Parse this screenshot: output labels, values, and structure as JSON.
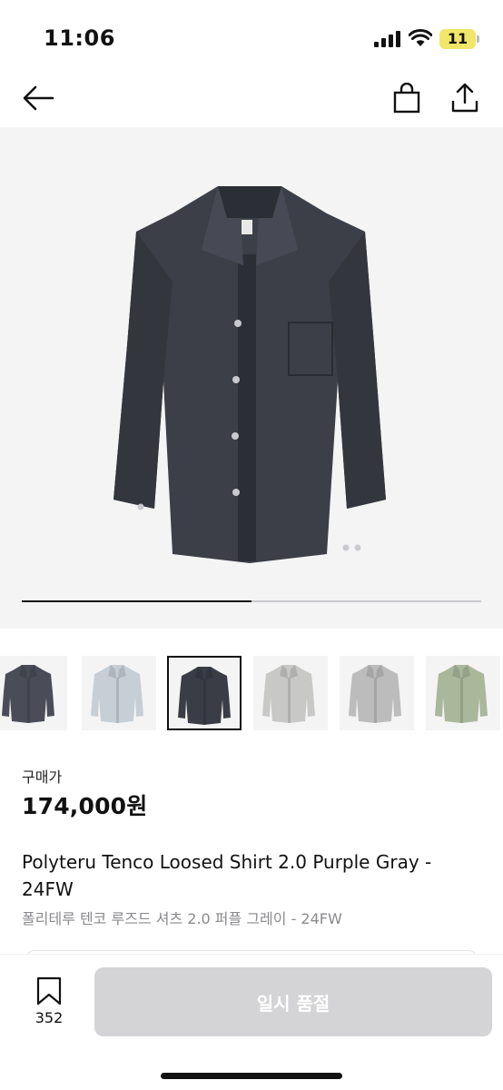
{
  "status_bar": {
    "time": "11:06",
    "battery": "11",
    "battery_color": "#f2e66a"
  },
  "nav": {
    "back_icon": "arrow-left-icon",
    "bag_icon": "shopping-bag-icon",
    "share_icon": "share-upload-icon"
  },
  "gallery": {
    "progress_fraction": 0.5,
    "thumbnails": [
      {
        "shirt_color": "#4a4d57",
        "selected": false
      },
      {
        "shirt_color": "#c7cfd6",
        "selected": false
      },
      {
        "shirt_color": "#3b3d46",
        "selected": true
      },
      {
        "shirt_color": "#c8c8c6",
        "selected": false
      },
      {
        "shirt_color": "#bcbcbc",
        "selected": false
      },
      {
        "shirt_color": "#a9b79a",
        "selected": false
      }
    ]
  },
  "product": {
    "price_label": "구매가",
    "price": "174,000원",
    "title_en": "Polyteru Tenco Loosed Shirt 2.0 Purple Gray - 24FW",
    "title_ko": "폴리테루 텐코 루즈드 셔츠 2.0 퍼플 그레이 - 24FW"
  },
  "bottom_bar": {
    "wish_icon": "bookmark-icon",
    "wish_count": "352",
    "action_label": "일시 품절"
  },
  "colors": {
    "shirt_main": "#3d3f48",
    "disabled_button": "#d4d4d6"
  }
}
